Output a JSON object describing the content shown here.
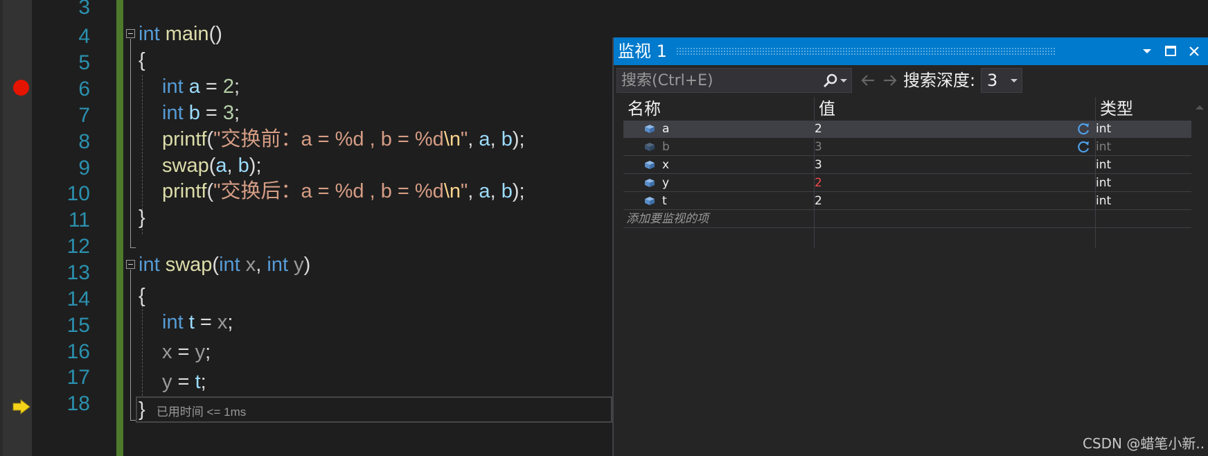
{
  "editor": {
    "line_numbers": [
      "3",
      "4",
      "5",
      "6",
      "7",
      "8",
      "9",
      "10",
      "11",
      "12",
      "13",
      "14",
      "15",
      "16",
      "17",
      "18"
    ],
    "lines": {
      "l4": {
        "kw": "int",
        "fn": "main",
        "p": "()"
      },
      "l5": {
        "p": "{"
      },
      "l6": {
        "kw": "int",
        "var": "a",
        "op": " = ",
        "num": "2",
        "end": ";"
      },
      "l7": {
        "kw": "int",
        "var": "b",
        "op": " = ",
        "num": "3",
        "end": ";"
      },
      "l8": {
        "fn": "printf",
        "p1": "(",
        "s1": "\"交换前：a = %d , b = %d",
        "esc": "\\n",
        "s2": "\"",
        "c1": ", ",
        "v1": "a",
        "c2": ", ",
        "v2": "b",
        "end": ");"
      },
      "l9": {
        "fn": "swap",
        "p1": "(",
        "v1": "a",
        "c1": ", ",
        "v2": "b",
        "end": ");"
      },
      "l10": {
        "fn": "printf",
        "p1": "(",
        "s1": "\"交换后：a = %d , b = %d",
        "esc": "\\n",
        "s2": "\"",
        "c1": ", ",
        "v1": "a",
        "c2": ", ",
        "v2": "b",
        "end": ");"
      },
      "l11": {
        "p": "}"
      },
      "l12": {
        "kw1": "int",
        "fn": "swap",
        "p1": "(",
        "kw2": "int",
        "pa1": "x",
        "c1": ", ",
        "kw3": "int",
        "pa2": "y",
        "end": ")"
      },
      "l13": {
        "p": "{"
      },
      "l14": {
        "kw": "int",
        "var": "t",
        "op": " = ",
        "pa": "x",
        "end": ";"
      },
      "l15": {
        "pa1": "x",
        "op": " = ",
        "pa2": "y",
        "end": ";"
      },
      "l16": {
        "pa": "y",
        "op": " = ",
        "var": "t",
        "end": ";"
      },
      "l17": {
        "p": "}",
        "perf": "已用时间 <= 1ms"
      }
    }
  },
  "watch": {
    "title": "监视 1",
    "search_placeholder": "搜索(Ctrl+E)",
    "depth_label": "搜索深度:",
    "depth_value": "3",
    "columns": [
      "名称",
      "值",
      "类型"
    ],
    "rows": [
      {
        "name": "a",
        "value": "2",
        "type": "int"
      },
      {
        "name": "b",
        "value": "3",
        "type": "int"
      },
      {
        "name": "x",
        "value": "3",
        "type": "int"
      },
      {
        "name": "y",
        "value": "2",
        "type": "int"
      },
      {
        "name": "t",
        "value": "2",
        "type": "int"
      }
    ],
    "add_watch": "添加要监视的项"
  },
  "colors": {
    "accent": "#007acc",
    "breakpoint": "#e51400",
    "changed_value": "#f14c4c",
    "keyword": "#569cd6",
    "string": "#d69d85",
    "function": "#dcdcaa"
  },
  "icons": [
    "breakpoint-icon",
    "instruction-pointer-icon",
    "fold-icon",
    "search-icon",
    "refresh-icon",
    "variable-icon"
  ],
  "watermark": "CSDN @蜡笔小新.."
}
